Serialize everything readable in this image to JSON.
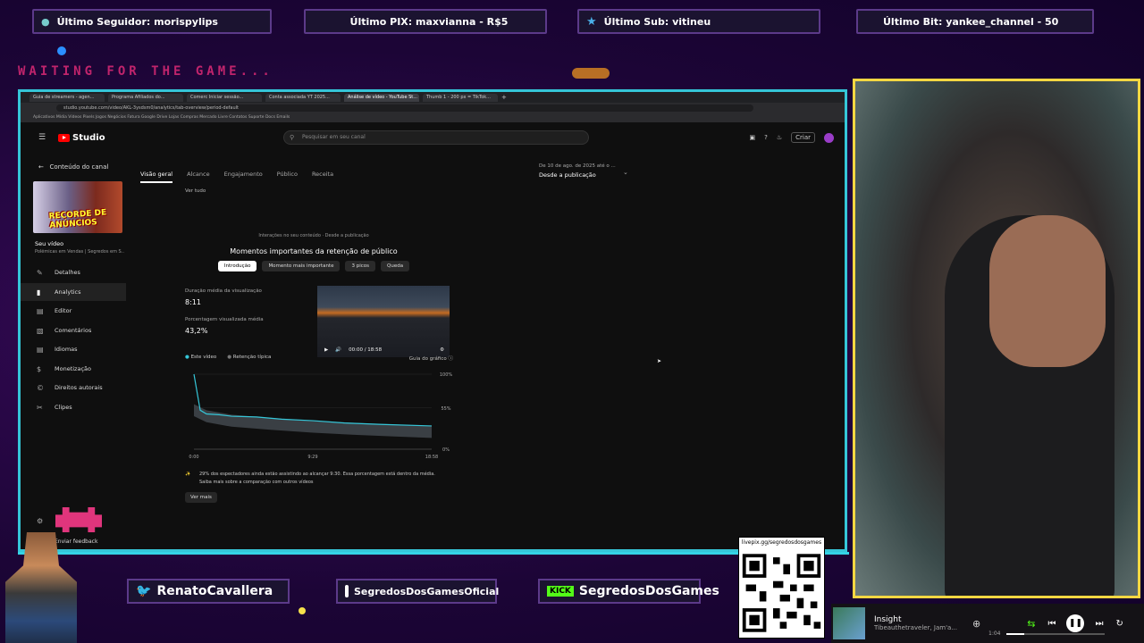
{
  "alerts": {
    "follower": "Último Seguidor: morispylips",
    "pix": "Último PIX: maxvianna - R$5",
    "sub": "Último Sub: vitineu",
    "bit": "Último Bit: yankee_channel - 50"
  },
  "waiting": "WAITING FOR THE GAME...",
  "browser": {
    "tabs": [
      "Guia de streamers - agen...",
      "Programa Afiliados do...",
      "Comerc Iniciar sessão...",
      "Conta associada YT 2025...",
      "Análise de vídeo - YouTube St...",
      "Thumb 1 - 200 px = TikTok..."
    ],
    "url": "studio.youtube.com/video/AKL-3ysdsm0/analytics/tab-overview/period-default",
    "bookmarks": "Aplicativos   Mídia    Vídeos    Pixels    Jogos    Negócios    Fatura    Google Drive    Lojas   Compras    Mercado Livre    Contatos   Suporte   Docs   Emails"
  },
  "studio": {
    "logo": "Studio",
    "search_placeholder": "Pesquisar em seu canal",
    "create": "Criar",
    "back_label": "Conteúdo do canal",
    "thumb_badge": "RECORDE DE ANÚNCIOS",
    "video_label": "Seu vídeo",
    "video_subtitle": "Polêmicas em Vendas | Segredos em S...",
    "nav": [
      "Detalhes",
      "Analytics",
      "Editor",
      "Comentários",
      "Idiomas",
      "Monetização",
      "Direitos autorais",
      "Clipes"
    ],
    "feedback": "Enviar feedback",
    "tabs": [
      "Visão geral",
      "Alcance",
      "Engajamento",
      "Público",
      "Receita"
    ],
    "date_top": "De 10 de ago. de 2025 até o ...",
    "date_range": "Desde a publicação",
    "ver_tudo": "Ver tudo",
    "panel_caption": "Interações no seu conteúdo · Desde a publicação",
    "panel_title": "Momentos importantes da retenção de público",
    "chips": [
      "Introdução",
      "Momento mais importante",
      "3 picos",
      "Queda"
    ],
    "avg_duration_label": "Duração média da visualização",
    "avg_duration_value": "8:11",
    "avg_pct_label": "Porcentagem visualizada média",
    "avg_pct_value": "43,2%",
    "player_time": "00:00 / 18:58",
    "legend_video": "Este vídeo",
    "legend_typical": "Retenção típica",
    "chart_guide": "Guia do gráfico",
    "insight": "29% dos espectadores ainda estão assistindo ao alcançar 9:30. Essa porcentagem está dentro da média. Saiba mais sobre a comparação com outros vídeos",
    "see_more": "Ver mais"
  },
  "chart_data": {
    "type": "line",
    "x_ticks": [
      "0:00",
      "9:29",
      "18:58"
    ],
    "y_ticks": [
      "100%",
      "55%",
      "0%"
    ],
    "series": [
      {
        "name": "Este vídeo",
        "x": [
          0,
          0.5,
          1,
          2,
          3,
          5,
          7,
          9.5,
          12,
          15,
          18.97
        ],
        "values": [
          100,
          52,
          47,
          46,
          44,
          43,
          40,
          38,
          35,
          33,
          31
        ]
      },
      {
        "name": "Retenção típica",
        "x": [
          0,
          1,
          3,
          6,
          9.5,
          13,
          16,
          18.97
        ],
        "values": [
          52,
          44,
          38,
          34,
          30,
          27,
          25,
          23
        ]
      }
    ],
    "ylim": [
      0,
      100
    ]
  },
  "socials": {
    "twitter": "RenatoCavallera",
    "instagram": "SegredosDosGamesOficial",
    "kick": "SegredosDosGames",
    "kick_brand": "KICK"
  },
  "qr_label": "livepix.gg/segredosdosgames",
  "music": {
    "title": "Insight",
    "artist": "Tibeauthetraveler, Jam'a...",
    "time": "1:04"
  },
  "colors": {
    "accent": "#35c6d8",
    "cam_border": "#f4d742",
    "yt_red": "#ff0000"
  }
}
